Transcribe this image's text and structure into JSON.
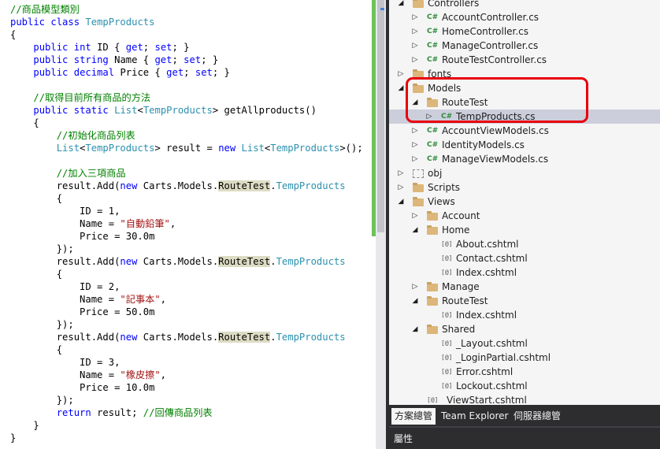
{
  "editor": {
    "lines": [
      [
        {
          "t": "cmt",
          "v": "//商品模型類別"
        }
      ],
      [
        {
          "t": "kw",
          "v": "public"
        },
        {
          "t": "plain",
          "v": " "
        },
        {
          "t": "kw",
          "v": "class"
        },
        {
          "t": "plain",
          "v": " "
        },
        {
          "t": "type",
          "v": "TempProducts"
        }
      ],
      [
        {
          "t": "plain",
          "v": "{"
        }
      ],
      [
        {
          "t": "plain",
          "v": "    "
        },
        {
          "t": "kw",
          "v": "public"
        },
        {
          "t": "plain",
          "v": " "
        },
        {
          "t": "kw",
          "v": "int"
        },
        {
          "t": "plain",
          "v": " ID { "
        },
        {
          "t": "kw",
          "v": "get"
        },
        {
          "t": "plain",
          "v": "; "
        },
        {
          "t": "kw",
          "v": "set"
        },
        {
          "t": "plain",
          "v": "; }"
        }
      ],
      [
        {
          "t": "plain",
          "v": "    "
        },
        {
          "t": "kw",
          "v": "public"
        },
        {
          "t": "plain",
          "v": " "
        },
        {
          "t": "kw",
          "v": "string"
        },
        {
          "t": "plain",
          "v": " Name { "
        },
        {
          "t": "kw",
          "v": "get"
        },
        {
          "t": "plain",
          "v": "; "
        },
        {
          "t": "kw",
          "v": "set"
        },
        {
          "t": "plain",
          "v": "; }"
        }
      ],
      [
        {
          "t": "plain",
          "v": "    "
        },
        {
          "t": "kw",
          "v": "public"
        },
        {
          "t": "plain",
          "v": " "
        },
        {
          "t": "kw",
          "v": "decimal"
        },
        {
          "t": "plain",
          "v": " Price { "
        },
        {
          "t": "kw",
          "v": "get"
        },
        {
          "t": "plain",
          "v": "; "
        },
        {
          "t": "kw",
          "v": "set"
        },
        {
          "t": "plain",
          "v": "; }"
        }
      ],
      [],
      [
        {
          "t": "plain",
          "v": "    "
        },
        {
          "t": "cmt",
          "v": "//取得目前所有商品的方法"
        }
      ],
      [
        {
          "t": "plain",
          "v": "    "
        },
        {
          "t": "kw",
          "v": "public"
        },
        {
          "t": "plain",
          "v": " "
        },
        {
          "t": "kw",
          "v": "static"
        },
        {
          "t": "plain",
          "v": " "
        },
        {
          "t": "type",
          "v": "List"
        },
        {
          "t": "plain",
          "v": "<"
        },
        {
          "t": "type",
          "v": "TempProducts"
        },
        {
          "t": "plain",
          "v": "> getAllproducts()"
        }
      ],
      [
        {
          "t": "plain",
          "v": "    {"
        }
      ],
      [
        {
          "t": "plain",
          "v": "        "
        },
        {
          "t": "cmt",
          "v": "//初始化商品列表"
        }
      ],
      [
        {
          "t": "plain",
          "v": "        "
        },
        {
          "t": "type",
          "v": "List"
        },
        {
          "t": "plain",
          "v": "<"
        },
        {
          "t": "type",
          "v": "TempProducts"
        },
        {
          "t": "plain",
          "v": "> result = "
        },
        {
          "t": "kw",
          "v": "new"
        },
        {
          "t": "plain",
          "v": " "
        },
        {
          "t": "type",
          "v": "List"
        },
        {
          "t": "plain",
          "v": "<"
        },
        {
          "t": "type",
          "v": "TempProducts"
        },
        {
          "t": "plain",
          "v": ">();"
        }
      ],
      [],
      [
        {
          "t": "plain",
          "v": "        "
        },
        {
          "t": "cmt",
          "v": "//加入三項商品"
        }
      ],
      [
        {
          "t": "plain",
          "v": "        result.Add("
        },
        {
          "t": "kw",
          "v": "new"
        },
        {
          "t": "plain",
          "v": " Carts.Models."
        },
        {
          "t": "hl",
          "v": "RouteTest"
        },
        {
          "t": "plain",
          "v": "."
        },
        {
          "t": "type",
          "v": "TempProducts"
        }
      ],
      [
        {
          "t": "plain",
          "v": "        {"
        }
      ],
      [
        {
          "t": "plain",
          "v": "            ID = 1,"
        }
      ],
      [
        {
          "t": "plain",
          "v": "            Name = "
        },
        {
          "t": "str",
          "v": "\"自動鉛筆\""
        },
        {
          "t": "plain",
          "v": ","
        }
      ],
      [
        {
          "t": "plain",
          "v": "            Price = 30.0m"
        }
      ],
      [
        {
          "t": "plain",
          "v": "        });"
        }
      ],
      [
        {
          "t": "plain",
          "v": "        result.Add("
        },
        {
          "t": "kw",
          "v": "new"
        },
        {
          "t": "plain",
          "v": " Carts.Models."
        },
        {
          "t": "hl",
          "v": "RouteTest"
        },
        {
          "t": "plain",
          "v": "."
        },
        {
          "t": "type",
          "v": "TempProducts"
        }
      ],
      [
        {
          "t": "plain",
          "v": "        {"
        }
      ],
      [
        {
          "t": "plain",
          "v": "            ID = 2,"
        }
      ],
      [
        {
          "t": "plain",
          "v": "            Name = "
        },
        {
          "t": "str",
          "v": "\"記事本\""
        },
        {
          "t": "plain",
          "v": ","
        }
      ],
      [
        {
          "t": "plain",
          "v": "            Price = 50.0m"
        }
      ],
      [
        {
          "t": "plain",
          "v": "        });"
        }
      ],
      [
        {
          "t": "plain",
          "v": "        result.Add("
        },
        {
          "t": "kw",
          "v": "new"
        },
        {
          "t": "plain",
          "v": " Carts.Models."
        },
        {
          "t": "hl",
          "v": "RouteTest"
        },
        {
          "t": "plain",
          "v": "."
        },
        {
          "t": "type",
          "v": "TempProducts"
        }
      ],
      [
        {
          "t": "plain",
          "v": "        {"
        }
      ],
      [
        {
          "t": "plain",
          "v": "            ID = 3,"
        }
      ],
      [
        {
          "t": "plain",
          "v": "            Name = "
        },
        {
          "t": "str",
          "v": "\"橡皮擦\""
        },
        {
          "t": "plain",
          "v": ","
        }
      ],
      [
        {
          "t": "plain",
          "v": "            Price = 10.0m"
        }
      ],
      [
        {
          "t": "plain",
          "v": "        });"
        }
      ],
      [
        {
          "t": "plain",
          "v": "        "
        },
        {
          "t": "kw",
          "v": "return"
        },
        {
          "t": "plain",
          "v": " result; "
        },
        {
          "t": "cmt",
          "v": "//回傳商品列表"
        }
      ],
      [
        {
          "t": "plain",
          "v": "    }"
        }
      ],
      [
        {
          "t": "plain",
          "v": "}"
        }
      ]
    ]
  },
  "solution_explorer": {
    "items": [
      {
        "label": "Controllers",
        "icon": "folder-icon",
        "expander": "expanded",
        "level": 1
      },
      {
        "label": "AccountController.cs",
        "icon": "csharp-file-icon",
        "expander": "collapsed",
        "level": 2
      },
      {
        "label": "HomeController.cs",
        "icon": "csharp-file-icon",
        "expander": "collapsed",
        "level": 2
      },
      {
        "label": "ManageController.cs",
        "icon": "csharp-file-icon",
        "expander": "collapsed",
        "level": 2
      },
      {
        "label": "RouteTestController.cs",
        "icon": "csharp-file-icon",
        "expander": "collapsed",
        "level": 2
      },
      {
        "label": "fonts",
        "icon": "folder-icon",
        "expander": "collapsed",
        "level": 1
      },
      {
        "label": "Models",
        "icon": "folder-icon",
        "expander": "expanded",
        "level": 1
      },
      {
        "label": "RouteTest",
        "icon": "folder-icon",
        "expander": "expanded",
        "level": 2
      },
      {
        "label": "TempProducts.cs",
        "icon": "csharp-file-icon",
        "expander": "collapsed",
        "level": 3,
        "selected": true
      },
      {
        "label": "AccountViewModels.cs",
        "icon": "csharp-file-icon",
        "expander": "collapsed",
        "level": 2
      },
      {
        "label": "IdentityModels.cs",
        "icon": "csharp-file-icon",
        "expander": "collapsed",
        "level": 2
      },
      {
        "label": "ManageViewModels.cs",
        "icon": "csharp-file-icon",
        "expander": "collapsed",
        "level": 2
      },
      {
        "label": "obj",
        "icon": "hidden-folder-icon",
        "expander": "collapsed",
        "level": 1
      },
      {
        "label": "Scripts",
        "icon": "folder-icon",
        "expander": "collapsed",
        "level": 1
      },
      {
        "label": "Views",
        "icon": "folder-icon",
        "expander": "expanded",
        "level": 1
      },
      {
        "label": "Account",
        "icon": "folder-icon",
        "expander": "collapsed",
        "level": 2
      },
      {
        "label": "Home",
        "icon": "folder-icon",
        "expander": "expanded",
        "level": 2
      },
      {
        "label": "About.cshtml",
        "icon": "razor-file-icon",
        "expander": "none",
        "level": 3
      },
      {
        "label": "Contact.cshtml",
        "icon": "razor-file-icon",
        "expander": "none",
        "level": 3
      },
      {
        "label": "Index.cshtml",
        "icon": "razor-file-icon",
        "expander": "none",
        "level": 3
      },
      {
        "label": "Manage",
        "icon": "folder-icon",
        "expander": "collapsed",
        "level": 2
      },
      {
        "label": "RouteTest",
        "icon": "folder-icon",
        "expander": "expanded",
        "level": 2
      },
      {
        "label": "Index.cshtml",
        "icon": "razor-file-icon",
        "expander": "none",
        "level": 3
      },
      {
        "label": "Shared",
        "icon": "folder-icon",
        "expander": "expanded",
        "level": 2
      },
      {
        "label": "_Layout.cshtml",
        "icon": "razor-file-icon",
        "expander": "none",
        "level": 3
      },
      {
        "label": "_LoginPartial.cshtml",
        "icon": "razor-file-icon",
        "expander": "none",
        "level": 3
      },
      {
        "label": "Error.cshtml",
        "icon": "razor-file-icon",
        "expander": "none",
        "level": 3
      },
      {
        "label": "Lockout.cshtml",
        "icon": "razor-file-icon",
        "expander": "none",
        "level": 3
      },
      {
        "label": "_ViewStart.cshtml",
        "icon": "razor-file-icon",
        "expander": "none",
        "level": 2
      }
    ],
    "icon_glyphs": {
      "csharp": "C#",
      "razor": "[@]"
    }
  },
  "bottom_tabs": {
    "solution_explorer_label": "方案總管",
    "team_explorer_label": "Team Explorer",
    "server_explorer_label": "伺服器總管"
  },
  "properties": {
    "title": "屬性"
  },
  "colors": {
    "keyword": "#0000ff",
    "type": "#2b91af",
    "string": "#a31515",
    "comment": "#008000",
    "identifier_highlight": "#dcdcc4",
    "callout_border": "#e8000b",
    "selected_row": "#cccedb"
  }
}
